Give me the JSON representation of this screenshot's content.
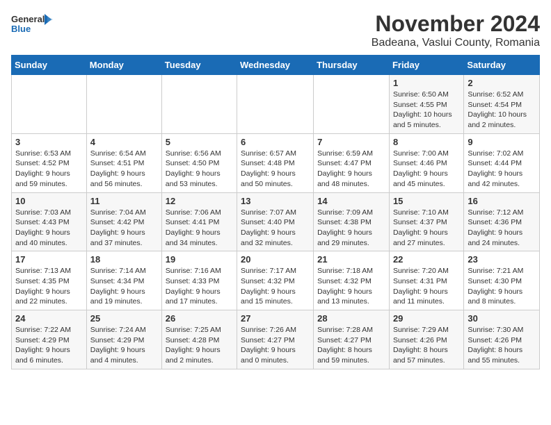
{
  "logo": {
    "line1": "General",
    "line2": "Blue"
  },
  "title": "November 2024",
  "location": "Badeana, Vaslui County, Romania",
  "weekdays": [
    "Sunday",
    "Monday",
    "Tuesday",
    "Wednesday",
    "Thursday",
    "Friday",
    "Saturday"
  ],
  "weeks": [
    [
      {
        "day": "",
        "info": ""
      },
      {
        "day": "",
        "info": ""
      },
      {
        "day": "",
        "info": ""
      },
      {
        "day": "",
        "info": ""
      },
      {
        "day": "",
        "info": ""
      },
      {
        "day": "1",
        "info": "Sunrise: 6:50 AM\nSunset: 4:55 PM\nDaylight: 10 hours\nand 5 minutes."
      },
      {
        "day": "2",
        "info": "Sunrise: 6:52 AM\nSunset: 4:54 PM\nDaylight: 10 hours\nand 2 minutes."
      }
    ],
    [
      {
        "day": "3",
        "info": "Sunrise: 6:53 AM\nSunset: 4:52 PM\nDaylight: 9 hours\nand 59 minutes."
      },
      {
        "day": "4",
        "info": "Sunrise: 6:54 AM\nSunset: 4:51 PM\nDaylight: 9 hours\nand 56 minutes."
      },
      {
        "day": "5",
        "info": "Sunrise: 6:56 AM\nSunset: 4:50 PM\nDaylight: 9 hours\nand 53 minutes."
      },
      {
        "day": "6",
        "info": "Sunrise: 6:57 AM\nSunset: 4:48 PM\nDaylight: 9 hours\nand 50 minutes."
      },
      {
        "day": "7",
        "info": "Sunrise: 6:59 AM\nSunset: 4:47 PM\nDaylight: 9 hours\nand 48 minutes."
      },
      {
        "day": "8",
        "info": "Sunrise: 7:00 AM\nSunset: 4:46 PM\nDaylight: 9 hours\nand 45 minutes."
      },
      {
        "day": "9",
        "info": "Sunrise: 7:02 AM\nSunset: 4:44 PM\nDaylight: 9 hours\nand 42 minutes."
      }
    ],
    [
      {
        "day": "10",
        "info": "Sunrise: 7:03 AM\nSunset: 4:43 PM\nDaylight: 9 hours\nand 40 minutes."
      },
      {
        "day": "11",
        "info": "Sunrise: 7:04 AM\nSunset: 4:42 PM\nDaylight: 9 hours\nand 37 minutes."
      },
      {
        "day": "12",
        "info": "Sunrise: 7:06 AM\nSunset: 4:41 PM\nDaylight: 9 hours\nand 34 minutes."
      },
      {
        "day": "13",
        "info": "Sunrise: 7:07 AM\nSunset: 4:40 PM\nDaylight: 9 hours\nand 32 minutes."
      },
      {
        "day": "14",
        "info": "Sunrise: 7:09 AM\nSunset: 4:38 PM\nDaylight: 9 hours\nand 29 minutes."
      },
      {
        "day": "15",
        "info": "Sunrise: 7:10 AM\nSunset: 4:37 PM\nDaylight: 9 hours\nand 27 minutes."
      },
      {
        "day": "16",
        "info": "Sunrise: 7:12 AM\nSunset: 4:36 PM\nDaylight: 9 hours\nand 24 minutes."
      }
    ],
    [
      {
        "day": "17",
        "info": "Sunrise: 7:13 AM\nSunset: 4:35 PM\nDaylight: 9 hours\nand 22 minutes."
      },
      {
        "day": "18",
        "info": "Sunrise: 7:14 AM\nSunset: 4:34 PM\nDaylight: 9 hours\nand 19 minutes."
      },
      {
        "day": "19",
        "info": "Sunrise: 7:16 AM\nSunset: 4:33 PM\nDaylight: 9 hours\nand 17 minutes."
      },
      {
        "day": "20",
        "info": "Sunrise: 7:17 AM\nSunset: 4:32 PM\nDaylight: 9 hours\nand 15 minutes."
      },
      {
        "day": "21",
        "info": "Sunrise: 7:18 AM\nSunset: 4:32 PM\nDaylight: 9 hours\nand 13 minutes."
      },
      {
        "day": "22",
        "info": "Sunrise: 7:20 AM\nSunset: 4:31 PM\nDaylight: 9 hours\nand 11 minutes."
      },
      {
        "day": "23",
        "info": "Sunrise: 7:21 AM\nSunset: 4:30 PM\nDaylight: 9 hours\nand 8 minutes."
      }
    ],
    [
      {
        "day": "24",
        "info": "Sunrise: 7:22 AM\nSunset: 4:29 PM\nDaylight: 9 hours\nand 6 minutes."
      },
      {
        "day": "25",
        "info": "Sunrise: 7:24 AM\nSunset: 4:29 PM\nDaylight: 9 hours\nand 4 minutes."
      },
      {
        "day": "26",
        "info": "Sunrise: 7:25 AM\nSunset: 4:28 PM\nDaylight: 9 hours\nand 2 minutes."
      },
      {
        "day": "27",
        "info": "Sunrise: 7:26 AM\nSunset: 4:27 PM\nDaylight: 9 hours\nand 0 minutes."
      },
      {
        "day": "28",
        "info": "Sunrise: 7:28 AM\nSunset: 4:27 PM\nDaylight: 8 hours\nand 59 minutes."
      },
      {
        "day": "29",
        "info": "Sunrise: 7:29 AM\nSunset: 4:26 PM\nDaylight: 8 hours\nand 57 minutes."
      },
      {
        "day": "30",
        "info": "Sunrise: 7:30 AM\nSunset: 4:26 PM\nDaylight: 8 hours\nand 55 minutes."
      }
    ]
  ]
}
